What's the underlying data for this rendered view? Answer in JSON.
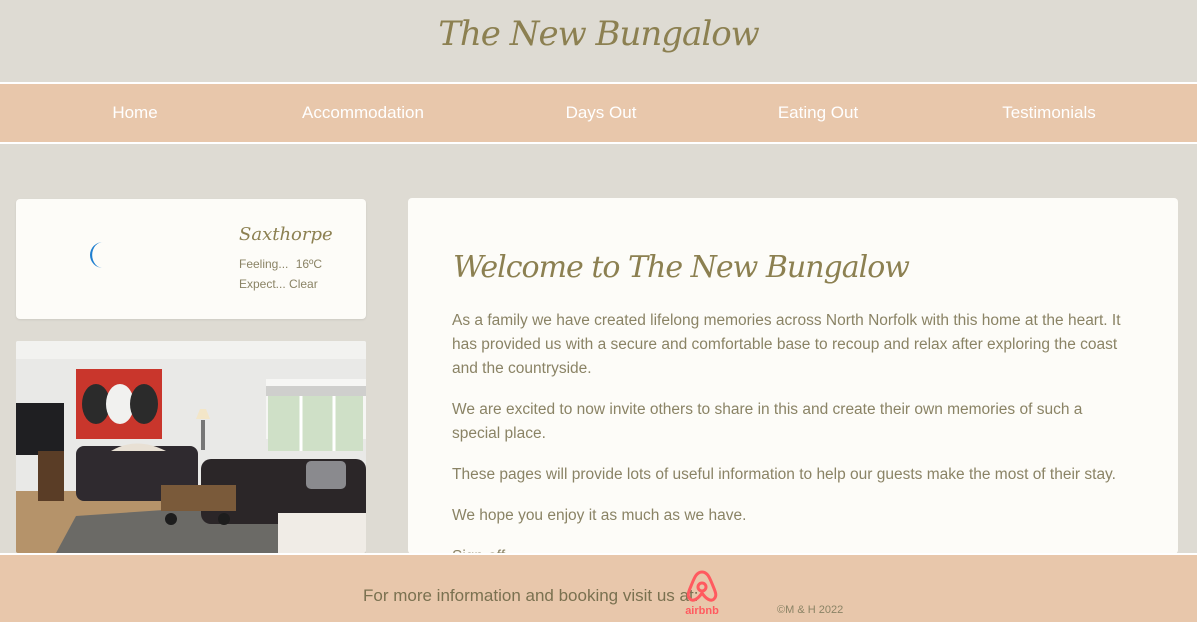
{
  "site": {
    "title": "The New Bungalow"
  },
  "nav": {
    "items": [
      {
        "label": "Home"
      },
      {
        "label": "Accommodation"
      },
      {
        "label": "Days Out"
      },
      {
        "label": "Eating Out"
      },
      {
        "label": "Testimonials"
      }
    ]
  },
  "weather": {
    "icon": "crescent-moon-icon",
    "location": "Saxthorpe",
    "feeling_label": "Feeling...",
    "temperature": "16ºC",
    "expect_label": "Expect...",
    "condition": "Clear"
  },
  "photo": {
    "subject": "living-room-photo"
  },
  "main": {
    "heading": "Welcome to The New Bungalow",
    "paragraphs": [
      "As a family we have created lifelong memories across North Norfolk with this home at the heart. It has provided us with a secure and comfortable base to recoup and relax after exploring the coast and the countryside.",
      "We are excited to now invite others to share in this and create their own memories of such a special place.",
      "These pages will provide lots of useful information to help our guests make the most of their stay.",
      "We hope you enjoy it as much as we have.",
      "Sign-off..."
    ]
  },
  "footer": {
    "booking_text": "For more information and booking visit us at:",
    "airbnb_label": "airbnb",
    "copyright": "©M & H 2022"
  },
  "colors": {
    "background": "#dedbd3",
    "accent_band": "#e8c7ab",
    "title_text": "#8c8051",
    "body_text": "#8a8365",
    "card": "#fdfcf8",
    "airbnb": "#ff5a5f",
    "moon": "#1f7fd0"
  }
}
